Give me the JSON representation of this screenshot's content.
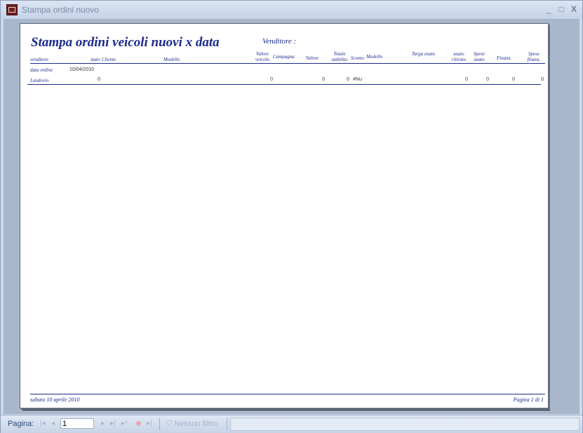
{
  "window": {
    "title": "Stampa ordini nuovo",
    "minimize": "_",
    "maximize": "□",
    "close": "X"
  },
  "report": {
    "title": "Stampa ordini veicoli nuovi x data",
    "venditore_label": "Venditore :",
    "headers": {
      "venditore": "venditore",
      "stato": "stato",
      "cliente": "Cliente",
      "modello": "Modello",
      "valore_veicolo_1": "Valore",
      "valore_veicolo_2": "veicolo",
      "campagna": "Campagna",
      "valore": "Valore",
      "totale_stabilito_1": "Totale",
      "totale_stabilito_2": "stabilito",
      "sconto": "Sconto",
      "modello2": "Modello",
      "targa_usato": "Targa usato",
      "usato_ritirato_1": "usato",
      "usato_ritirato_2": "ritirato",
      "spese_usato_1": "Spese",
      "spese_usato_2": "usato",
      "finanz": "Finanz.",
      "spese_finanz_1": "Spese",
      "spese_finanz_2": "finanz."
    },
    "row_date": {
      "label": "data ordine",
      "value": "10/04/2010"
    },
    "row_data": {
      "venditore": "Landovio",
      "qty": "0",
      "valore_veicolo": "0",
      "valore": "0",
      "totale": "0",
      "sconto": "#Nu",
      "usato_ritirato": "0",
      "spese_usato": "0",
      "finanz": "0",
      "spese_finanz": "0"
    },
    "footer_date": "sabato 10 aprile 2010",
    "footer_page": "Pagina 1 di 1"
  },
  "statusbar": {
    "page_label": "Pagina:",
    "page_value": "1",
    "filter_label": "Nessun filtro"
  },
  "colors": {
    "report_blue": "#1b2a8c",
    "window_bg": "#cfd9e8"
  }
}
